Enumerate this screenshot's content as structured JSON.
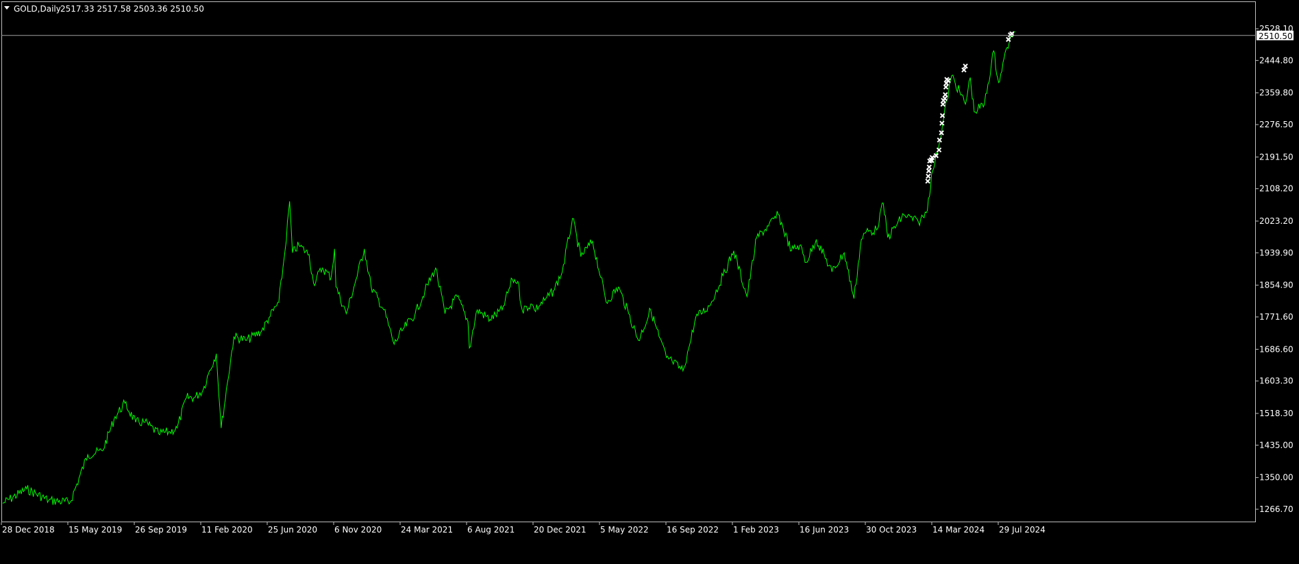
{
  "header": {
    "symbol_label": "GOLD,Daily",
    "ohlc_text": "2517.33 2517.58 2503.36 2510.50",
    "collapse_icon": "triangle-down-icon"
  },
  "colors": {
    "background": "#000000",
    "frame": "#c0c0c0",
    "price_series": "#00ff00",
    "markers": "#ffffff",
    "price_line": "#a0a0a0",
    "price_tag_bg": "#ffffff",
    "price_tag_text": "#000000",
    "axis_text": "#ffffff"
  },
  "chart_data": {
    "type": "line",
    "title": "",
    "xlabel": "",
    "ylabel": "",
    "ylim": [
      1230,
      2560
    ],
    "grid": false,
    "y_ticks": [
      "1266.70",
      "1350.00",
      "1435.00",
      "1518.30",
      "1603.30",
      "1686.60",
      "1771.60",
      "1854.90",
      "1939.90",
      "2023.20",
      "2108.20",
      "2191.50",
      "2276.50",
      "2359.80",
      "2444.80",
      "2528.10"
    ],
    "x_ticks": [
      "28 Dec 2018",
      "15 May 2019",
      "26 Sep 2019",
      "11 Feb 2020",
      "25 Jun 2020",
      "6 Nov 2020",
      "24 Mar 2021",
      "6 Aug 2021",
      "20 Dec 2021",
      "5 May 2022",
      "16 Sep 2022",
      "1 Feb 2023",
      "16 Jun 2023",
      "30 Oct 2023",
      "14 Mar 2024",
      "29 Jul 2024"
    ],
    "last_price": "2510.50",
    "series": [
      {
        "x": [
          "2018-12-28",
          "2019-02-15",
          "2019-04-01",
          "2019-05-15",
          "2019-06-20",
          "2019-07-20",
          "2019-08-15",
          "2019-09-04",
          "2019-09-26",
          "2019-10-15",
          "2019-11-12",
          "2019-12-05",
          "2019-12-20",
          "2020-01-08",
          "2020-01-25",
          "2020-02-11",
          "2020-02-24",
          "2020-03-09",
          "2020-03-19",
          "2020-04-01",
          "2020-04-14",
          "2020-05-10",
          "2020-06-10",
          "2020-06-25",
          "2020-07-15",
          "2020-07-28",
          "2020-08-06",
          "2020-08-12",
          "2020-08-25",
          "2020-09-15",
          "2020-09-24",
          "2020-10-12",
          "2020-10-30",
          "2020-11-06",
          "2020-11-09",
          "2020-11-30",
          "2020-12-20",
          "2021-01-06",
          "2021-01-20",
          "2021-02-15",
          "2021-03-08",
          "2021-03-24",
          "2021-04-20",
          "2021-05-10",
          "2021-06-01",
          "2021-06-20",
          "2021-07-15",
          "2021-08-06",
          "2021-08-09",
          "2021-08-25",
          "2021-09-20",
          "2021-10-15",
          "2021-11-05",
          "2021-11-16",
          "2021-11-25",
          "2021-12-15",
          "2021-12-20",
          "2022-01-10",
          "2022-01-28",
          "2022-02-15",
          "2022-03-08",
          "2022-03-25",
          "2022-04-18",
          "2022-05-05",
          "2022-05-16",
          "2022-06-10",
          "2022-07-01",
          "2022-07-21",
          "2022-08-15",
          "2022-09-01",
          "2022-09-16",
          "2022-09-28",
          "2022-10-20",
          "2022-11-03",
          "2022-11-15",
          "2022-12-13",
          "2023-01-10",
          "2023-02-01",
          "2023-02-28",
          "2023-03-20",
          "2023-04-13",
          "2023-05-03",
          "2023-05-30",
          "2023-06-16",
          "2023-06-29",
          "2023-07-20",
          "2023-08-21",
          "2023-09-15",
          "2023-10-05",
          "2023-10-20",
          "2023-10-30",
          "2023-11-20",
          "2023-12-04",
          "2023-12-13",
          "2024-01-15",
          "2024-02-14",
          "2024-03-01",
          "2024-03-14",
          "2024-03-28",
          "2024-04-12",
          "2024-04-22",
          "2024-05-20",
          "2024-05-30",
          "2024-06-07",
          "2024-06-28",
          "2024-07-17",
          "2024-07-25",
          "2024-07-29",
          "2024-08-05",
          "2024-08-20",
          "2024-08-30"
        ],
        "y": [
          1282,
          1320,
          1290,
          1285,
          1410,
          1420,
          1510,
          1545,
          1495,
          1495,
          1465,
          1470,
          1480,
          1560,
          1560,
          1580,
          1630,
          1675,
          1480,
          1600,
          1720,
          1710,
          1735,
          1770,
          1810,
          1950,
          2075,
          1940,
          1960,
          1935,
          1860,
          1900,
          1875,
          1950,
          1850,
          1780,
          1870,
          1950,
          1850,
          1790,
          1700,
          1735,
          1780,
          1840,
          1900,
          1780,
          1825,
          1760,
          1690,
          1790,
          1765,
          1790,
          1870,
          1865,
          1790,
          1805,
          1790,
          1815,
          1840,
          1890,
          2030,
          1930,
          1970,
          1875,
          1810,
          1850,
          1780,
          1710,
          1790,
          1720,
          1665,
          1655,
          1630,
          1700,
          1770,
          1800,
          1880,
          1945,
          1825,
          1980,
          2010,
          2040,
          1945,
          1960,
          1915,
          1975,
          1890,
          1940,
          1820,
          1975,
          1995,
          2000,
          2070,
          1980,
          2040,
          2020,
          2045,
          2155,
          2230,
          2340,
          2405,
          2330,
          2400,
          2310,
          2330,
          2470,
          2400,
          2390,
          2440,
          2505,
          2520
        ]
      }
    ],
    "markers": {
      "symbol": "x",
      "points": [
        [
          "2024-03-04",
          2128
        ],
        [
          "2024-03-05",
          2141
        ],
        [
          "2024-03-06",
          2155
        ],
        [
          "2024-03-07",
          2165
        ],
        [
          "2024-03-08",
          2181
        ],
        [
          "2024-03-11",
          2184
        ],
        [
          "2024-03-12",
          2182
        ],
        [
          "2024-03-13",
          2190
        ],
        [
          "2024-03-21",
          2195
        ],
        [
          "2024-03-27",
          2210
        ],
        [
          "2024-03-28",
          2236
        ],
        [
          "2024-04-01",
          2255
        ],
        [
          "2024-04-02",
          2280
        ],
        [
          "2024-04-03",
          2300
        ],
        [
          "2024-04-04",
          2330
        ],
        [
          "2024-04-05",
          2340
        ],
        [
          "2024-04-08",
          2345
        ],
        [
          "2024-04-09",
          2355
        ],
        [
          "2024-04-10",
          2375
        ],
        [
          "2024-04-11",
          2385
        ],
        [
          "2024-04-12",
          2395
        ],
        [
          "2024-04-15",
          2392
        ],
        [
          "2024-05-17",
          2420
        ],
        [
          "2024-05-20",
          2430
        ],
        [
          "2024-08-16",
          2500
        ],
        [
          "2024-08-20",
          2512
        ],
        [
          "2024-08-23",
          2515
        ]
      ]
    }
  }
}
